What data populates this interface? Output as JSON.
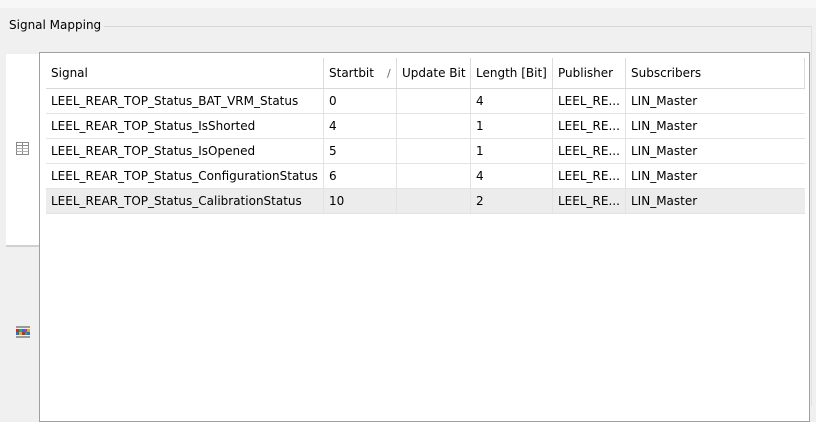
{
  "group": {
    "title": "Signal Mapping"
  },
  "tabs": [
    {
      "icon": "table-icon"
    },
    {
      "icon": "bit-map-icon"
    }
  ],
  "table": {
    "columns": [
      "Signal",
      "Startbit",
      "Update Bit",
      "Length [Bit]",
      "Publisher",
      "Subscribers"
    ],
    "sort_indicator": "/",
    "rows": [
      [
        "LEEL_REAR_TOP_Status_BAT_VRM_Status",
        "0",
        "",
        "4",
        "LEEL_RE...",
        "LIN_Master"
      ],
      [
        "LEEL_REAR_TOP_Status_IsShorted",
        "4",
        "",
        "1",
        "LEEL_RE...",
        "LIN_Master"
      ],
      [
        "LEEL_REAR_TOP_Status_IsOpened",
        "5",
        "",
        "1",
        "LEEL_RE...",
        "LIN_Master"
      ],
      [
        "LEEL_REAR_TOP_Status_ConfigurationStatus",
        "6",
        "",
        "4",
        "LEEL_RE...",
        "LIN_Master"
      ],
      [
        "LEEL_REAR_TOP_Status_CalibrationStatus",
        "10",
        "",
        "2",
        "LEEL_RE...",
        "LIN_Master"
      ]
    ],
    "selected_row": 4
  }
}
